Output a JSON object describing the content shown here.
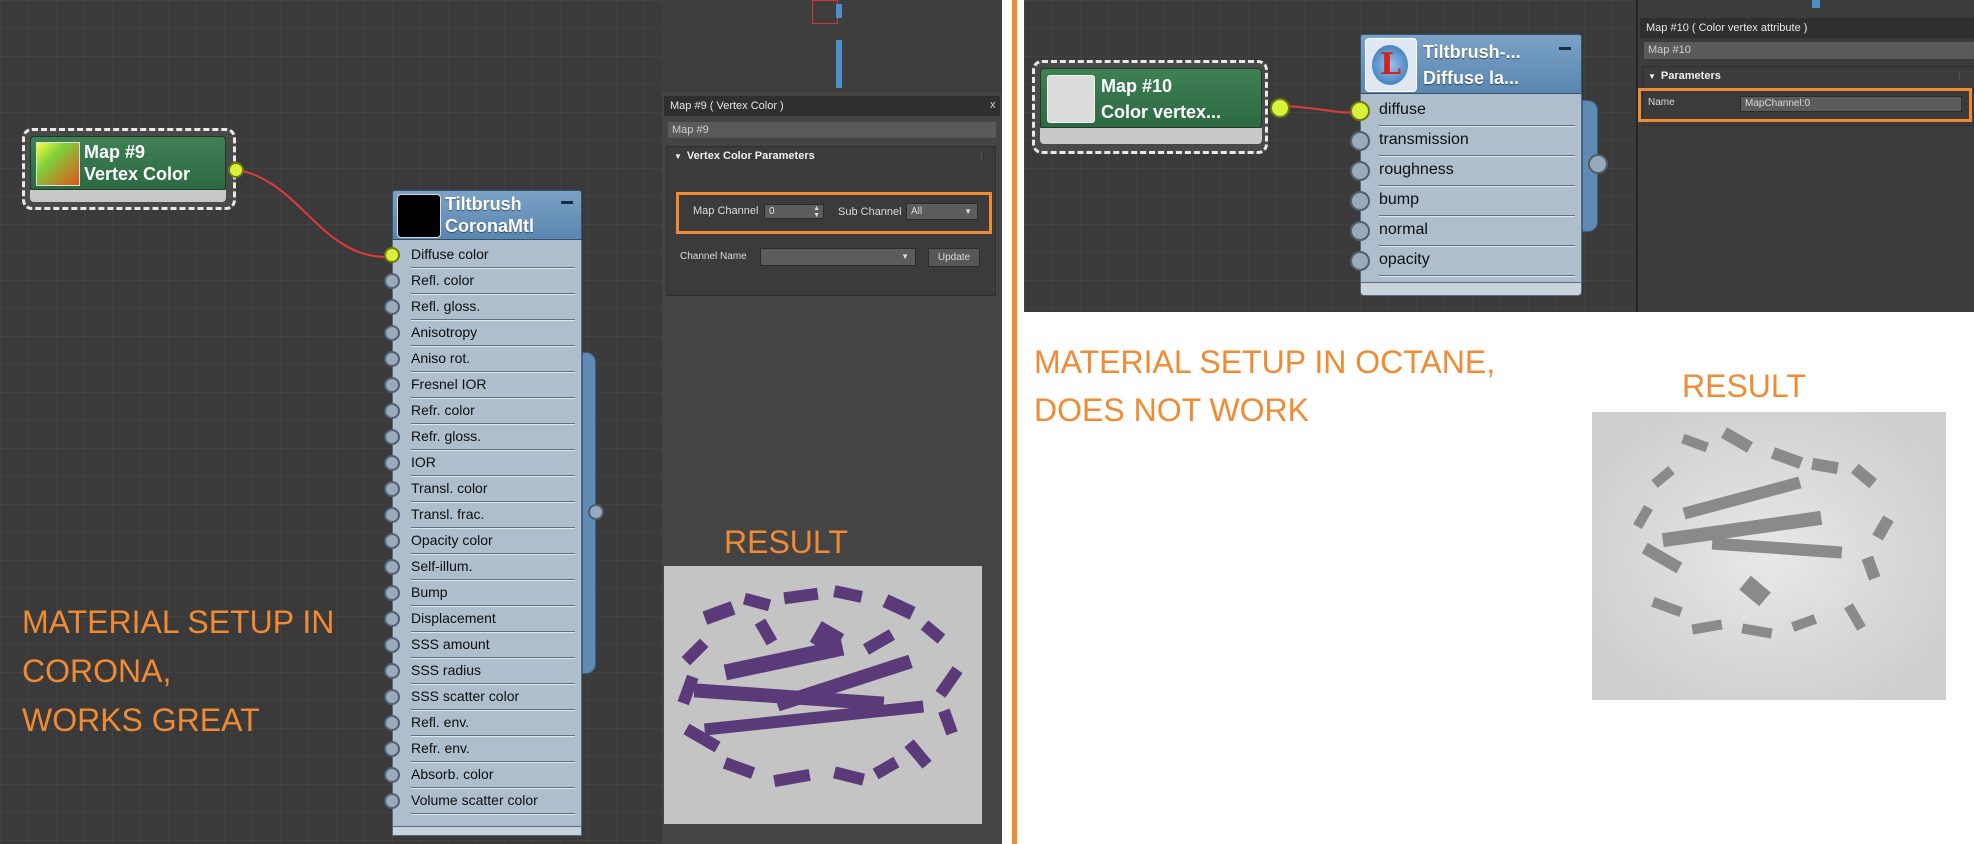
{
  "left": {
    "map_node": {
      "title_line1": "Map #9",
      "title_line2": "Vertex Color"
    },
    "material_node": {
      "title_line1": "Tiltbrush",
      "title_line2": "CoronaMtl",
      "slots": [
        "Diffuse color",
        "Refl. color",
        "Refl. gloss.",
        "Anisotropy",
        "Aniso rot.",
        "Fresnel IOR",
        "Refr. color",
        "Refr. gloss.",
        "IOR",
        "Transl. color",
        "Transl. frac.",
        "Opacity color",
        "Self-illum.",
        "Bump",
        "Displacement",
        "SSS amount",
        "SSS radius",
        "SSS scatter color",
        "Refl. env.",
        "Refr. env.",
        "Absorb. color",
        "Volume scatter color"
      ]
    },
    "panel": {
      "title": "Map #9  ( Vertex Color )",
      "name_field": "Map #9",
      "rollout_title": "Vertex Color Parameters",
      "map_channel_label": "Map Channel",
      "map_channel_value": "0",
      "sub_channel_label": "Sub Channel",
      "sub_channel_value": "All",
      "channel_name_label": "Channel Name",
      "update_button": "Update",
      "close": "x"
    },
    "result_label": "RESULT",
    "note_lines": [
      "MATERIAL SETUP IN",
      "CORONA,",
      "WORKS GREAT"
    ]
  },
  "right": {
    "map_node": {
      "title_line1": "Map #10",
      "title_line2": "Color vertex..."
    },
    "material_node": {
      "title_line1": "Tiltbrush-...",
      "title_line2": "Diffuse la...",
      "slots": [
        "diffuse",
        "transmission",
        "roughness",
        "bump",
        "normal",
        "opacity"
      ]
    },
    "panel": {
      "title": "Map #10  ( Color vertex attribute )",
      "name_field": "Map #10",
      "rollout_title": "Parameters",
      "name_label": "Name",
      "name_value": "MapChannel:0"
    },
    "result_label": "RESULT",
    "note_lines": [
      "MATERIAL SETUP IN OCTANE,",
      "DOES NOT WORK"
    ]
  },
  "colors": {
    "accent_orange": "#f08a33",
    "node_green": "#2d6a42",
    "mtl_blue": "#5a86b0",
    "socket_active": "#d8f23a",
    "wire_red": "#e23a3a"
  },
  "icons": [
    "rollout-collapse-icon",
    "dropdown-arrow-icon",
    "spinner-arrows-icon",
    "close-icon",
    "minimize-icon"
  ]
}
